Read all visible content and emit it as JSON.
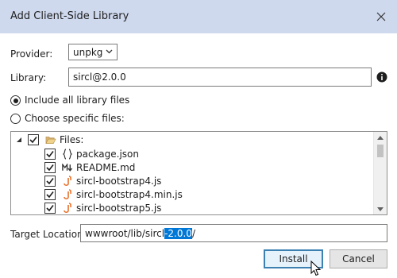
{
  "window": {
    "title": "Add Client-Side Library"
  },
  "provider": {
    "label": "Provider:",
    "value": "unpkg"
  },
  "library": {
    "label": "Library:",
    "value": "sircl@2.0.0"
  },
  "options": {
    "include_all": {
      "label": "Include all library files",
      "selected": true
    },
    "choose_specific": {
      "label": "Choose specific files:",
      "selected": false
    }
  },
  "tree": {
    "root_label": "Files:",
    "files": [
      {
        "name": "package.json",
        "icon": "json-file-icon",
        "checked": true
      },
      {
        "name": "README.md",
        "icon": "markdown-file-icon",
        "checked": true
      },
      {
        "name": "sircl-bootstrap4.js",
        "icon": "js-file-icon",
        "checked": true
      },
      {
        "name": "sircl-bootstrap4.min.js",
        "icon": "js-file-icon",
        "checked": true
      },
      {
        "name": "sircl-bootstrap5.js",
        "icon": "js-file-icon",
        "checked": true
      }
    ]
  },
  "target": {
    "label": "Target Location:",
    "value_prefix": "wwwroot/lib/sircl",
    "value_selected": "-2.0.0",
    "value_suffix": "/"
  },
  "buttons": {
    "install": "Install",
    "cancel": "Cancel"
  },
  "colors": {
    "titlebar": "#cfd9ee",
    "accent": "#0078d7",
    "js_icon": "#e8702a"
  }
}
